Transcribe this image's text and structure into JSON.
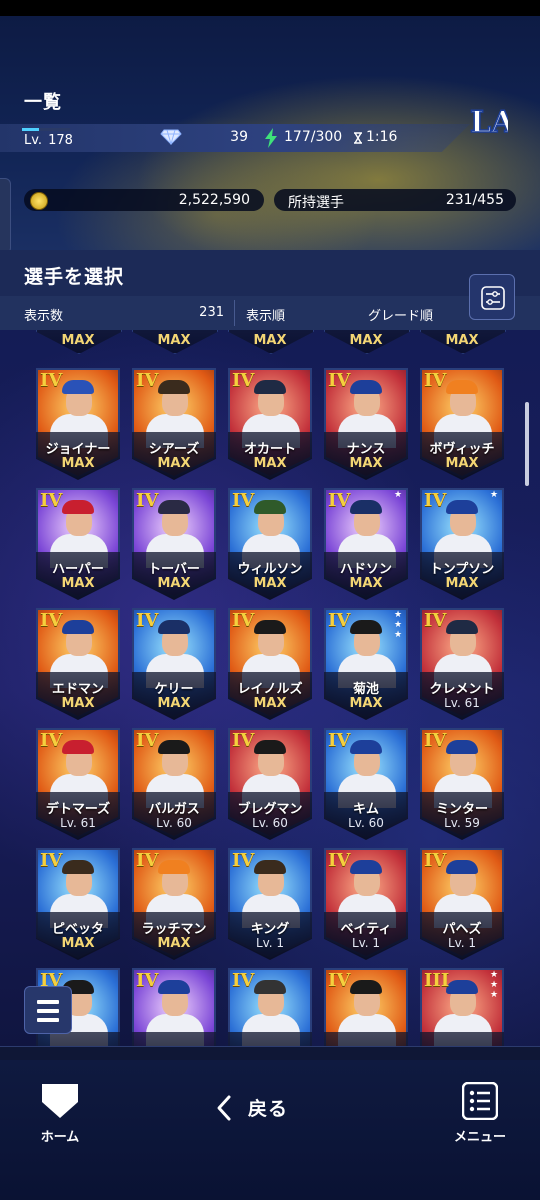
{
  "header": {
    "title": "一覧",
    "team_logo": "LA",
    "level_label": "Lv.",
    "level_value": "178",
    "level_progress": 0.35,
    "gems": "39",
    "stamina": "177/300",
    "timer": "1:16",
    "coins": "2,522,590",
    "roster_label": "所持選手",
    "roster_count": "231/455"
  },
  "select": {
    "title": "選手を選択",
    "count_label": "表示数",
    "count_value": "231",
    "sort_label": "表示順",
    "sort_value": "グレード順"
  },
  "top_peek": [
    "MAX",
    "MAX",
    "MAX",
    "MAX",
    "MAX"
  ],
  "cards": [
    {
      "name": "ジョイナー",
      "grade": "IV",
      "level": "MAX",
      "bg": "orange",
      "cap": "#2a52b8",
      "stars": 0
    },
    {
      "name": "シアーズ",
      "grade": "IV",
      "level": "MAX",
      "bg": "orange",
      "cap": "#3a2b1d",
      "stars": 0
    },
    {
      "name": "オカート",
      "grade": "IV",
      "level": "MAX",
      "bg": "red",
      "cap": "#1f2a44",
      "stars": 0
    },
    {
      "name": "ナンス",
      "grade": "IV",
      "level": "MAX",
      "bg": "red",
      "cap": "#1d3f9a",
      "stars": 0
    },
    {
      "name": "ボヴィッチ",
      "grade": "IV",
      "level": "MAX",
      "bg": "orange",
      "cap": "#f08020",
      "stars": 0
    },
    {
      "name": "ハーパー",
      "grade": "IV",
      "level": "MAX",
      "bg": "purple",
      "cap": "#c81f2f",
      "stars": 0
    },
    {
      "name": "トーバー",
      "grade": "IV",
      "level": "MAX",
      "bg": "purple",
      "cap": "#2a2a44",
      "stars": 0
    },
    {
      "name": "ウィルソン",
      "grade": "IV",
      "level": "MAX",
      "bg": "blue",
      "cap": "#2f5a2a",
      "stars": 0
    },
    {
      "name": "ハドソン",
      "grade": "IV",
      "level": "MAX",
      "bg": "purple",
      "cap": "#1a2f66",
      "stars": 1
    },
    {
      "name": "トンプソン",
      "grade": "IV",
      "level": "MAX",
      "bg": "blue",
      "cap": "#1d3f9a",
      "stars": 1
    },
    {
      "name": "エドマン",
      "grade": "IV",
      "level": "MAX",
      "bg": "orange",
      "cap": "#1d3f9a",
      "stars": 0
    },
    {
      "name": "ケリー",
      "grade": "IV",
      "level": "MAX",
      "bg": "blue",
      "cap": "#1a2f66",
      "stars": 0
    },
    {
      "name": "レイノルズ",
      "grade": "IV",
      "level": "MAX",
      "bg": "orange",
      "cap": "#1a1a1a",
      "stars": 0
    },
    {
      "name": "菊池",
      "grade": "IV",
      "level": "MAX",
      "bg": "blue",
      "cap": "#1a1a1a",
      "stars": 3
    },
    {
      "name": "クレメント",
      "grade": "IV",
      "level": "Lv. 61",
      "bg": "red",
      "cap": "#1f2a44",
      "stars": 0
    },
    {
      "name": "デトマーズ",
      "grade": "IV",
      "level": "Lv. 61",
      "bg": "orange",
      "cap": "#c81f2f",
      "stars": 0
    },
    {
      "name": "バルガス",
      "grade": "IV",
      "level": "Lv. 60",
      "bg": "orange",
      "cap": "#1a1a1a",
      "stars": 0
    },
    {
      "name": "ブレグマン",
      "grade": "IV",
      "level": "Lv. 60",
      "bg": "red",
      "cap": "#1a1a1a",
      "stars": 0
    },
    {
      "name": "キム",
      "grade": "IV",
      "level": "Lv. 60",
      "bg": "blue",
      "cap": "#1d3f9a",
      "stars": 0
    },
    {
      "name": "ミンター",
      "grade": "IV",
      "level": "Lv. 59",
      "bg": "orange",
      "cap": "#1d3f9a",
      "stars": 0
    },
    {
      "name": "ピベッタ",
      "grade": "IV",
      "level": "MAX",
      "bg": "blue",
      "cap": "#3a2b1d",
      "stars": 0
    },
    {
      "name": "ラッチマン",
      "grade": "IV",
      "level": "MAX",
      "bg": "orange",
      "cap": "#f08020",
      "stars": 0
    },
    {
      "name": "キング",
      "grade": "IV",
      "level": "Lv. 1",
      "bg": "blue",
      "cap": "#3a2b1d",
      "stars": 0
    },
    {
      "name": "ベイティ",
      "grade": "IV",
      "level": "Lv. 1",
      "bg": "red",
      "cap": "#1d3f9a",
      "stars": 0
    },
    {
      "name": "パヘズ",
      "grade": "IV",
      "level": "Lv. 1",
      "bg": "orange",
      "cap": "#1d3f9a",
      "stars": 0
    },
    {
      "name": "",
      "grade": "IV",
      "level": "",
      "bg": "blue",
      "cap": "#1a1a1a",
      "stars": 0
    },
    {
      "name": "",
      "grade": "IV",
      "level": "",
      "bg": "purple",
      "cap": "#1d3f9a",
      "stars": 0
    },
    {
      "name": "",
      "grade": "IV",
      "level": "",
      "bg": "blue",
      "cap": "#333333",
      "stars": 0
    },
    {
      "name": "",
      "grade": "IV",
      "level": "",
      "bg": "orange",
      "cap": "#1a1a1a",
      "stars": 0
    },
    {
      "name": "",
      "grade": "III",
      "level": "",
      "bg": "red",
      "cap": "#1d3f9a",
      "stars": 3
    }
  ],
  "nav": {
    "home_label": "ホーム",
    "back_label": "戻る",
    "menu_label": "メニュー"
  },
  "icons": {
    "gem": "diamond-icon",
    "stamina": "lightning-icon",
    "timer": "hourglass-icon",
    "coin": "coin-icon",
    "filter": "filter-sliders-icon",
    "home": "home-plate-icon",
    "back": "chevron-left-icon",
    "menu": "list-menu-icon"
  },
  "colors": {
    "grade": "#f5cf3e",
    "max": "#f3d674",
    "accent": "#4fd1ff"
  }
}
